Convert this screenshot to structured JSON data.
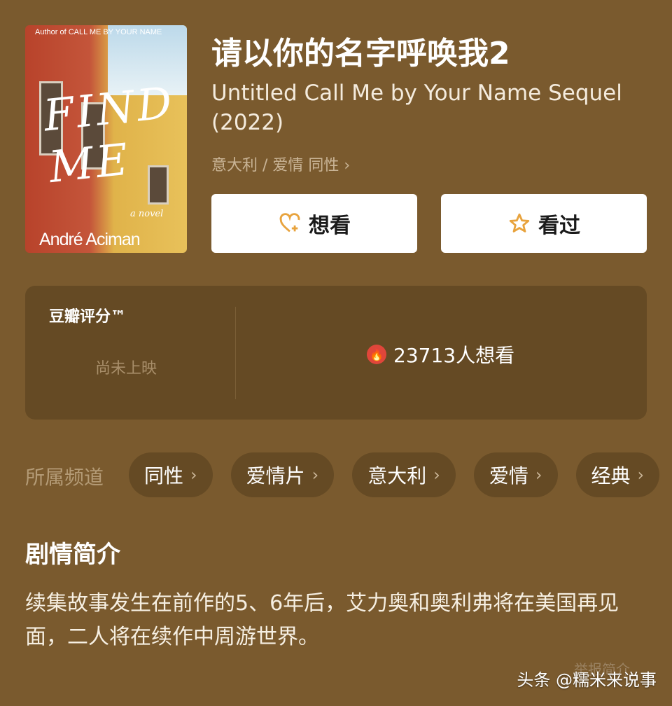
{
  "poster": {
    "author_line": "Author of CALL ME BY YOUR NAME",
    "title": "FIND ME",
    "subtitle": "a novel",
    "author": "André Aciman"
  },
  "movie": {
    "title_cn": "请以你的名字呼唤我2",
    "title_en": "Untitled Call Me by Your Name Sequel (2022)",
    "genre_line": "意大利 / 爱情 同性 ›"
  },
  "actions": {
    "want_label": "想看",
    "seen_label": "看过"
  },
  "rating": {
    "label": "豆瓣评分™",
    "status": "尚未上映",
    "want_count": "23713人想看",
    "fire_icon": "fire-icon"
  },
  "channels": {
    "label": "所属频道",
    "items": [
      "同性",
      "爱情片",
      "意大利",
      "爱情",
      "经典"
    ]
  },
  "synopsis": {
    "title": "剧情简介",
    "text": "续集故事发生在前作的5、6年后，艾力奥和奥利弗将在美国再见面，二人将在续作中周游世界。"
  },
  "footer": {
    "report": "举报简介",
    "watermark": "头条 @糯米来说事"
  },
  "colors": {
    "background": "#7a5a2e",
    "card": "#654a24",
    "accent": "#e8a33d"
  }
}
